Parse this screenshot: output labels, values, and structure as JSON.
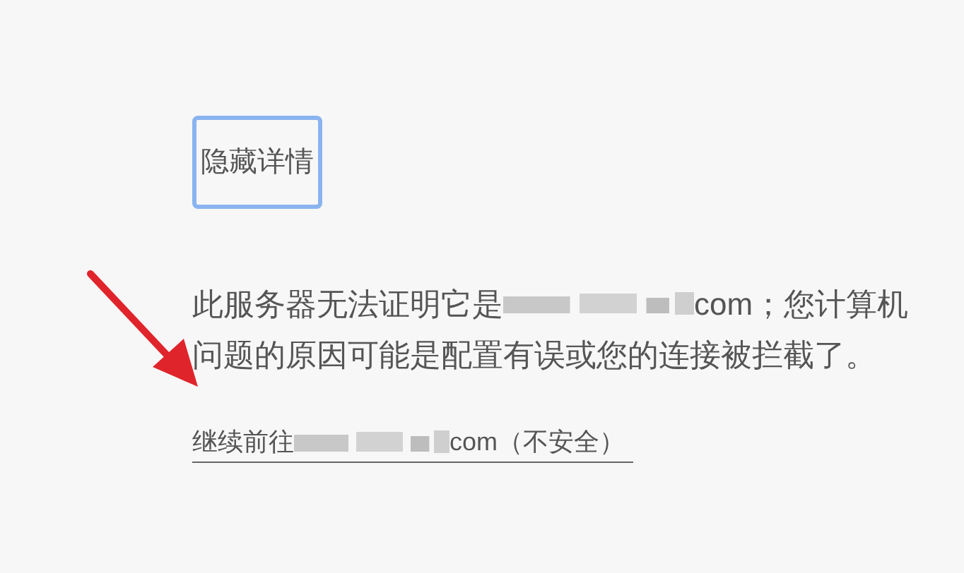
{
  "button": {
    "label": "隐藏详情"
  },
  "message": {
    "before": "此服务器无法证明它是",
    "after": "com；您计算机",
    "line_2": "问题的原因可能是配置有误或您的连接被拦截了。"
  },
  "link": {
    "before": "继续前往",
    "after": "com（不安全）"
  }
}
